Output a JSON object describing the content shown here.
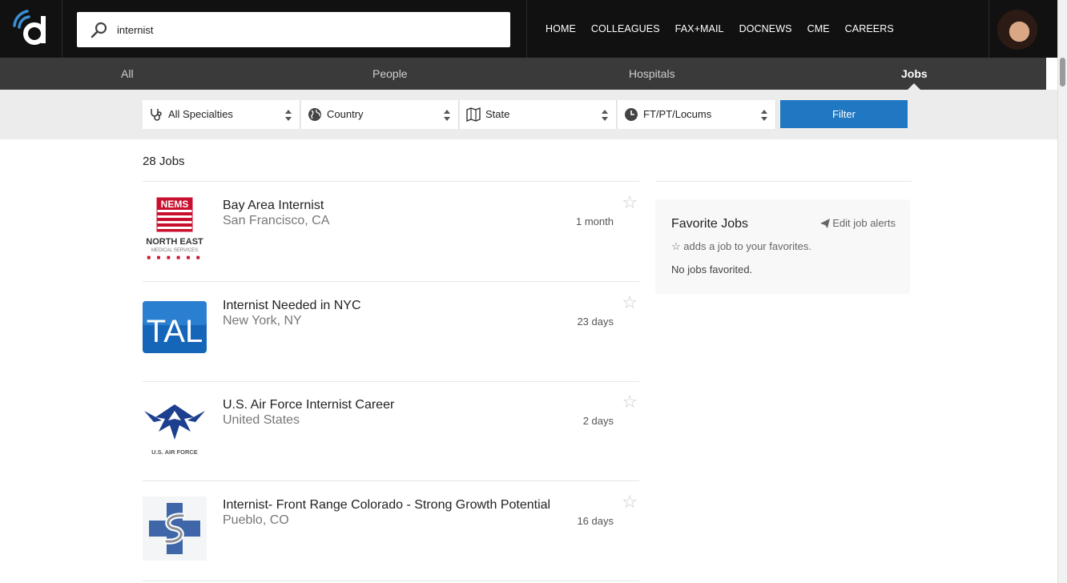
{
  "header": {
    "logo_icon": "docphin-d-logo",
    "search": {
      "value": "internist",
      "placeholder": "Search"
    },
    "nav": [
      "HOME",
      "COLLEAGUES",
      "FAX+MAIL",
      "DOCNEWS",
      "CME",
      "CAREERS"
    ],
    "avatar_icon": "user-avatar"
  },
  "tabs": {
    "all": "All",
    "people": "People",
    "hospitals": "Hospitals",
    "jobs": "Jobs",
    "active": "Jobs"
  },
  "filters": {
    "specialty": "All Specialties",
    "country": "Country",
    "state": "State",
    "type": "FT/PT/Locums",
    "button": "Filter"
  },
  "results_count": "28 Jobs",
  "jobs": [
    {
      "title": "Bay Area Internist",
      "location": "San Francisco, CA",
      "age": "1 month",
      "logo": "nems-logo",
      "logo_text": [
        "NEMS",
        "NORTH EAST",
        "MEDICAL SERVICES"
      ]
    },
    {
      "title": "Internist Needed in NYC",
      "location": "New York, NY",
      "age": "23 days",
      "logo": "tal-logo",
      "logo_text": [
        "TAL"
      ]
    },
    {
      "title": "U.S. Air Force Internist Career",
      "location": "United States",
      "age": "2 days",
      "logo": "us-air-force-logo",
      "logo_text": [
        "U.S. AIR FORCE"
      ]
    },
    {
      "title": "Internist- Front Range Colorado - Strong Growth Potential",
      "location": "Pueblo, CO",
      "age": "16 days",
      "logo": "cross-s-logo",
      "logo_text": []
    }
  ],
  "favorites": {
    "heading": "Favorite Jobs",
    "edit_label": "Edit job alerts",
    "hint": "adds a job to your favorites.",
    "hint_icon": "star-outline-icon",
    "empty": "No jobs favorited."
  },
  "colors": {
    "topbar": "#111111",
    "tabbar": "#3a3a3a",
    "accent": "#1f78c1",
    "nems_red": "#c8102e",
    "tal_blue": "#1565b8"
  }
}
